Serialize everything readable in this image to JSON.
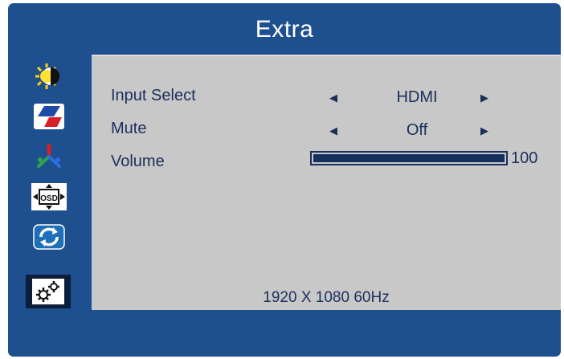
{
  "window": {
    "title": "Extra"
  },
  "sidebar": {
    "items": [
      {
        "icon": "brightness-contrast-icon",
        "selected": false
      },
      {
        "icon": "color-icon",
        "selected": false
      },
      {
        "icon": "rgb-adjust-icon",
        "selected": false
      },
      {
        "icon": "osd-position-icon",
        "selected": false
      },
      {
        "icon": "reset-icon",
        "selected": false
      },
      {
        "icon": "settings-gears-icon",
        "selected": true
      }
    ]
  },
  "menu": {
    "input_select": {
      "label": "Input Select",
      "value": "HDMI"
    },
    "mute": {
      "label": "Mute",
      "value": "Off"
    },
    "volume": {
      "label": "Volume",
      "value": "100",
      "level": 100
    }
  },
  "status": {
    "resolution": "1920 X 1080  60Hz"
  },
  "colors": {
    "frame": "#1e4f8e",
    "panel": "#c8c8c8",
    "text": "#1a2f5a",
    "selected_bg": "#0d1e3a"
  }
}
